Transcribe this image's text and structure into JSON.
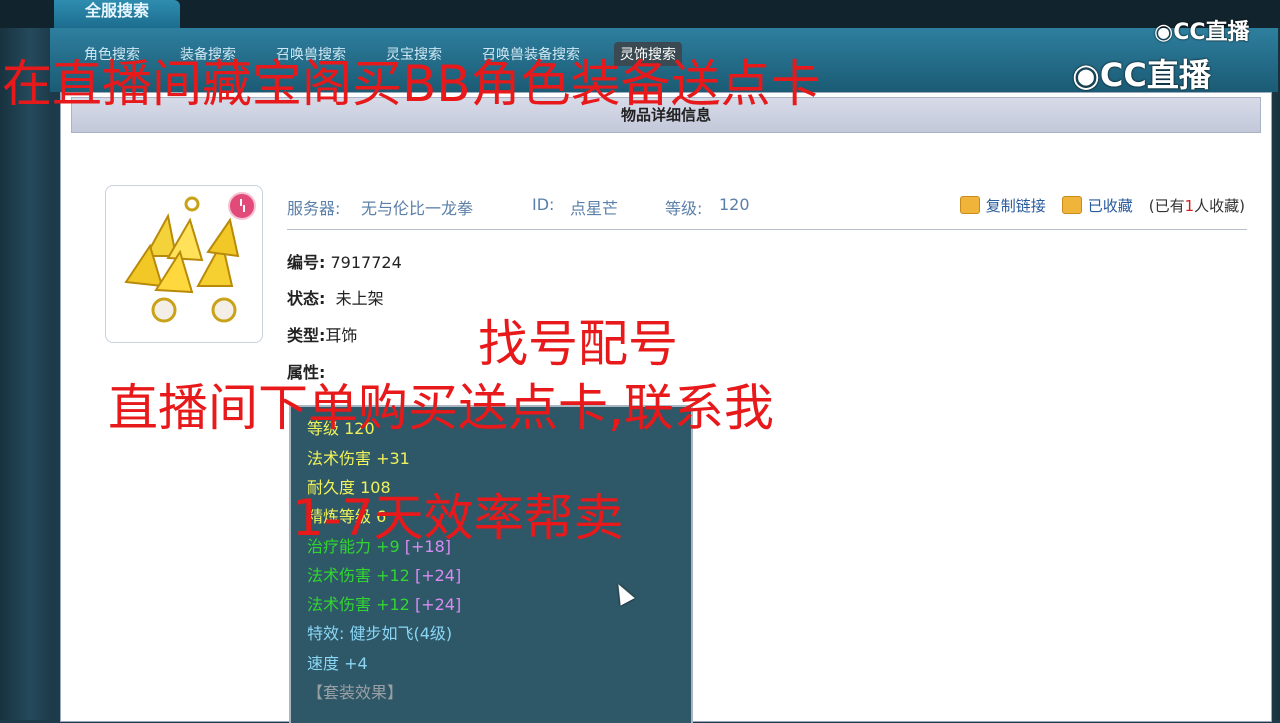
{
  "top_tab": "全服搜索",
  "subnav": [
    {
      "label": "角色搜索",
      "active": false
    },
    {
      "label": "装备搜索",
      "active": false
    },
    {
      "label": "召唤兽搜索",
      "active": false
    },
    {
      "label": "灵宝搜索",
      "active": false
    },
    {
      "label": "召唤兽装备搜索",
      "active": false
    },
    {
      "label": "灵饰搜索",
      "active": true
    }
  ],
  "panel": {
    "header": "物品详细信息",
    "server_label": "服务器:",
    "server_value": "无与伦比一龙拳",
    "id_label": "ID:",
    "id_value": "点星芒",
    "level_label": "等级:",
    "level_value": "120",
    "copy_link": "复制链接",
    "favorited": "已收藏",
    "fav_prefix": "(已有",
    "fav_count": "1",
    "fav_suffix": "人收藏)",
    "number_label": "编号:",
    "number_value": "7917724",
    "status_label": "状态:",
    "status_value": "未上架",
    "type_label": "类型:",
    "type_value": "耳饰",
    "attr_label": "属性:"
  },
  "attributes": {
    "level": "等级 120",
    "mag_dmg": "法术伤害 +31",
    "durability": "耐久度 108",
    "refine": "精炼等级 6",
    "heal": "治疗能力 +9",
    "heal_bonus": "[+18]",
    "mag1": "法术伤害 +12",
    "mag1_bonus": "[+24]",
    "mag2": "法术伤害 +12",
    "mag2_bonus": "[+24]",
    "effect": "特效: 健步如飞(4级)",
    "speed": "速度 +4",
    "set": "【套装效果】"
  },
  "overlays": {
    "line1": "在直播间藏宝阁买BB角色装备送点卡",
    "line2": "找号配号",
    "line3": "直播间下单购买送点卡,联系我",
    "line4": "1-7天效率帮卖"
  },
  "watermark": {
    "small": "CC直播",
    "large": "CC直播"
  },
  "colors": {
    "overlay_red": "#e8191a",
    "attr_yellow": "#f1f25a",
    "attr_green": "#31d62f",
    "attr_purple": "#d98bf2",
    "attr_blue": "#8ad6f5"
  }
}
